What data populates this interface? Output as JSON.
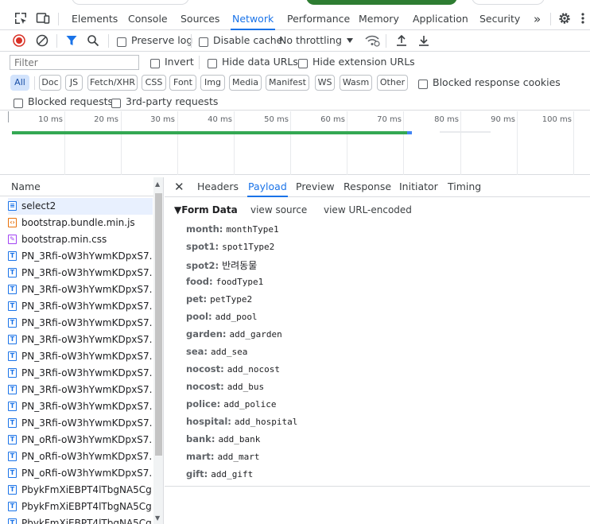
{
  "main_tabs": [
    "Elements",
    "Console",
    "Sources",
    "Network",
    "Performance",
    "Memory",
    "Application",
    "Security"
  ],
  "active_tab": "Network",
  "more_tabs_glyph": "»",
  "toolbar": {
    "preserve_log": "Preserve log",
    "disable_cache": "Disable cache",
    "throttling": "No throttling"
  },
  "filter": {
    "placeholder": "Filter",
    "invert": "Invert",
    "hide_data_urls": "Hide data URLs",
    "hide_extension_urls": "Hide extension URLs"
  },
  "type_chips": [
    "All",
    "Doc",
    "JS",
    "Fetch/XHR",
    "CSS",
    "Font",
    "Img",
    "Media",
    "Manifest",
    "WS",
    "Wasm",
    "Other"
  ],
  "active_chip": "All",
  "blocked_response_cookies": "Blocked response cookies",
  "blocked_requests": "Blocked requests",
  "third_party_requests": "3rd-party requests",
  "timeline_ticks": [
    "10 ms",
    "20 ms",
    "30 ms",
    "40 ms",
    "50 ms",
    "60 ms",
    "70 ms",
    "80 ms",
    "90 ms",
    "100 ms"
  ],
  "request_list": {
    "header": "Name",
    "rows": [
      {
        "name": "select2",
        "type": "doc",
        "selected": true
      },
      {
        "name": "bootstrap.bundle.min.js",
        "type": "js"
      },
      {
        "name": "bootstrap.min.css",
        "type": "css"
      },
      {
        "name": "PN_3Rfi-oW3hYwmKDpxS7...",
        "type": "txt"
      },
      {
        "name": "PN_3Rfi-oW3hYwmKDpxS7...",
        "type": "txt"
      },
      {
        "name": "PN_3Rfi-oW3hYwmKDpxS7...",
        "type": "txt"
      },
      {
        "name": "PN_3Rfi-oW3hYwmKDpxS7...",
        "type": "txt"
      },
      {
        "name": "PN_3Rfi-oW3hYwmKDpxS7...",
        "type": "txt"
      },
      {
        "name": "PN_3Rfi-oW3hYwmKDpxS7...",
        "type": "txt"
      },
      {
        "name": "PN_3Rfi-oW3hYwmKDpxS7...",
        "type": "txt"
      },
      {
        "name": "PN_3Rfi-oW3hYwmKDpxS7...",
        "type": "txt"
      },
      {
        "name": "PN_3Rfi-oW3hYwmKDpxS7...",
        "type": "txt"
      },
      {
        "name": "PN_3Rfi-oW3hYwmKDpxS7...",
        "type": "txt"
      },
      {
        "name": "PN_3Rfi-oW3hYwmKDpxS7...",
        "type": "txt"
      },
      {
        "name": "PN_oRfi-oW3hYwmKDpxS7...",
        "type": "txt"
      },
      {
        "name": "PN_oRfi-oW3hYwmKDpxS7...",
        "type": "txt"
      },
      {
        "name": "PN_oRfi-oW3hYwmKDpxS7...",
        "type": "txt"
      },
      {
        "name": "PbykFmXiEBPT4lTbgNA5Cg...",
        "type": "txt"
      },
      {
        "name": "PbykFmXiEBPT4lTbgNA5Cg...",
        "type": "txt"
      },
      {
        "name": "PbykFmXiEBPT4lTbgNA5Cg...",
        "type": "txt"
      }
    ]
  },
  "detail_tabs": [
    "Headers",
    "Payload",
    "Preview",
    "Response",
    "Initiator",
    "Timing"
  ],
  "active_detail_tab": "Payload",
  "form_data": {
    "heading": "▼Form Data",
    "view_source": "view source",
    "view_url_encoded": "view URL-encoded",
    "fields": [
      {
        "key": "month:",
        "value": "monthType1"
      },
      {
        "key": "spot1:",
        "value": "spot1Type2"
      },
      {
        "key": "spot2:",
        "value": "반려동물"
      },
      {
        "key": "food:",
        "value": "foodType1"
      },
      {
        "key": "pet:",
        "value": "petType2"
      },
      {
        "key": "pool:",
        "value": "add_pool"
      },
      {
        "key": "garden:",
        "value": "add_garden"
      },
      {
        "key": "sea:",
        "value": "add_sea"
      },
      {
        "key": "nocost:",
        "value": "add_nocost"
      },
      {
        "key": "nocost:",
        "value": "add_bus"
      },
      {
        "key": "police:",
        "value": "add_police"
      },
      {
        "key": "hospital:",
        "value": "add_hospital"
      },
      {
        "key": "bank:",
        "value": "add_bank"
      },
      {
        "key": "mart:",
        "value": "add_mart"
      },
      {
        "key": "gift:",
        "value": "add_gift"
      }
    ]
  },
  "colors": {
    "accent": "#1a73e8",
    "record": "#d93025",
    "timeline_bar": "#34a853",
    "selected_row": "#e8f0fe"
  }
}
